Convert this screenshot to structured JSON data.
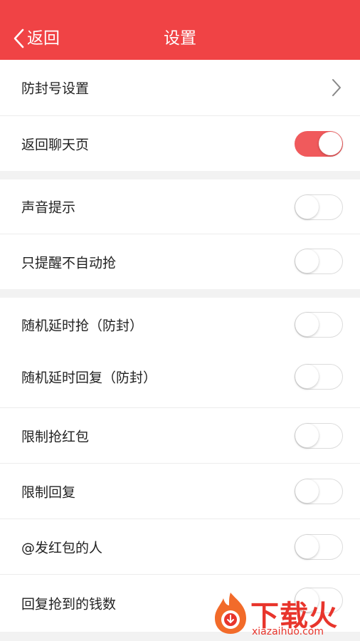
{
  "header": {
    "back_label": "返回",
    "title": "设置"
  },
  "rows": [
    {
      "label": "防封号设置",
      "control": "chevron"
    },
    {
      "label": "返回聊天页",
      "control": "toggle",
      "on": true
    },
    {
      "label": "声音提示",
      "control": "toggle",
      "on": false
    },
    {
      "label": "只提醒不自动抢",
      "control": "toggle",
      "on": false
    },
    {
      "label": "随机延时抢（防封）",
      "control": "toggle",
      "on": false
    },
    {
      "label": "随机延时回复（防封）",
      "control": "toggle",
      "on": false
    },
    {
      "label": "限制抢红包",
      "control": "toggle",
      "on": false
    },
    {
      "label": "限制回复",
      "control": "toggle",
      "on": false
    },
    {
      "label": "@发红包的人",
      "control": "toggle",
      "on": false
    },
    {
      "label": "回复抢到的钱数",
      "control": "toggle",
      "on": false
    }
  ],
  "watermark": {
    "brand": "下载火",
    "url": "xiazaihuo.com"
  },
  "colors": {
    "accent": "#f04345",
    "toggle_on": "#f05a5c"
  }
}
